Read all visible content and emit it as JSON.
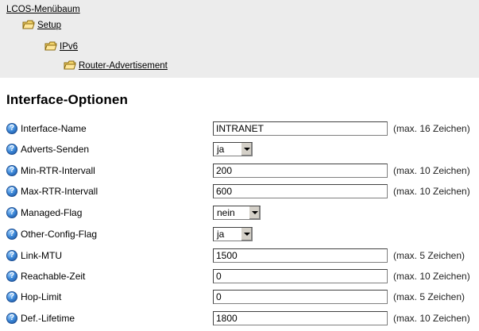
{
  "menu_tree": {
    "root": "LCOS-Menübaum",
    "setup": "Setup",
    "ipv6": "IPv6",
    "router_adv": "Router-Advertisement"
  },
  "page_title": "Interface-Optionen",
  "help_glyph": "?",
  "rows": [
    {
      "label": "Interface-Name",
      "value": "INTRANET",
      "hint": "(max. 16 Zeichen)"
    },
    {
      "label": "Adverts-Senden",
      "value": "ja"
    },
    {
      "label": "Min-RTR-Intervall",
      "value": "200",
      "hint": "(max. 10 Zeichen)"
    },
    {
      "label": "Max-RTR-Intervall",
      "value": "600",
      "hint": "(max. 10 Zeichen)"
    },
    {
      "label": "Managed-Flag",
      "value": "nein"
    },
    {
      "label": "Other-Config-Flag",
      "value": "ja"
    },
    {
      "label": "Link-MTU",
      "value": "1500",
      "hint": "(max. 5 Zeichen)"
    },
    {
      "label": "Reachable-Zeit",
      "value": "0",
      "hint": "(max. 10 Zeichen)"
    },
    {
      "label": "Hop-Limit",
      "value": "0",
      "hint": "(max. 5 Zeichen)"
    },
    {
      "label": "Def.-Lifetime",
      "value": "1800",
      "hint": "(max. 10 Zeichen)"
    }
  ]
}
